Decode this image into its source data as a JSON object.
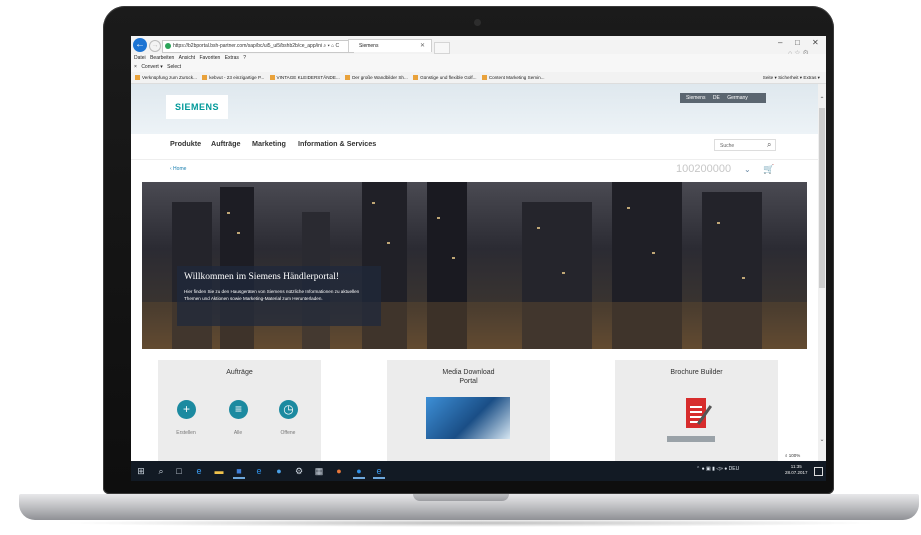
{
  "browser": {
    "url": "https://b2bportal.bsh-partner.com/sap/bc/ui5_ui5/bshb2b/ce_app/ini",
    "url_controls": "⌕ ▾ ⌂ C",
    "tab_title": "Siemens",
    "window_controls": [
      "–",
      "□",
      "✕"
    ],
    "menu": [
      "Datei",
      "Bearbeiten",
      "Ansicht",
      "Favoriten",
      "Extras",
      "?"
    ],
    "convert_bar": [
      "×",
      "Convert",
      "▾",
      "Select"
    ],
    "favorites": [
      "Verknüpfung zum Zurück...",
      "kebvut - 23 einzigartige P...",
      "VINTAGE KLEIDERSTÄNDE...",
      "Der große Wandbilder Sh...",
      "Günstige und flexible Golf...",
      "Content Marketing Semin..."
    ],
    "toolbar_right": [
      "Seite ▾",
      "Sicherheit ▾",
      "Extras ▾"
    ],
    "zoom": "100%"
  },
  "site": {
    "country_selector": {
      "brand": "Siemens",
      "country": "DE",
      "language": "Germany"
    },
    "logo": "SIEMENS",
    "nav": [
      "Produkte",
      "Aufträge",
      "Marketing",
      "Information & Services"
    ],
    "search_placeholder": "Suche",
    "breadcrumb": "‹ Home",
    "customer_number": "100200000",
    "hero": {
      "title": "Willkommen im Siemens Händlerportal!",
      "text": "Hier finden Sie zu den Hausgeräten von Siemens nützliche Informationen zu aktuellen Themen und Aktionen sowie Marketing-Material zum Herunterladen."
    },
    "cards": [
      {
        "title": "Aufträge",
        "actions": [
          {
            "label": "Erstellen",
            "icon": "plus-icon"
          },
          {
            "label": "Alle",
            "icon": "list-icon"
          },
          {
            "label": "Offene",
            "icon": "clock-icon"
          }
        ]
      },
      {
        "title": "Media Download\nPortal"
      },
      {
        "title": "Brochure Builder"
      }
    ],
    "accent_color": "#009999",
    "icon_circle_color": "#1c8aa0"
  },
  "taskbar": {
    "tray": "⌃  ●  ▣  ▮  ◁»  ●  DEU",
    "time": "11:35",
    "date": "28.07.2017"
  }
}
